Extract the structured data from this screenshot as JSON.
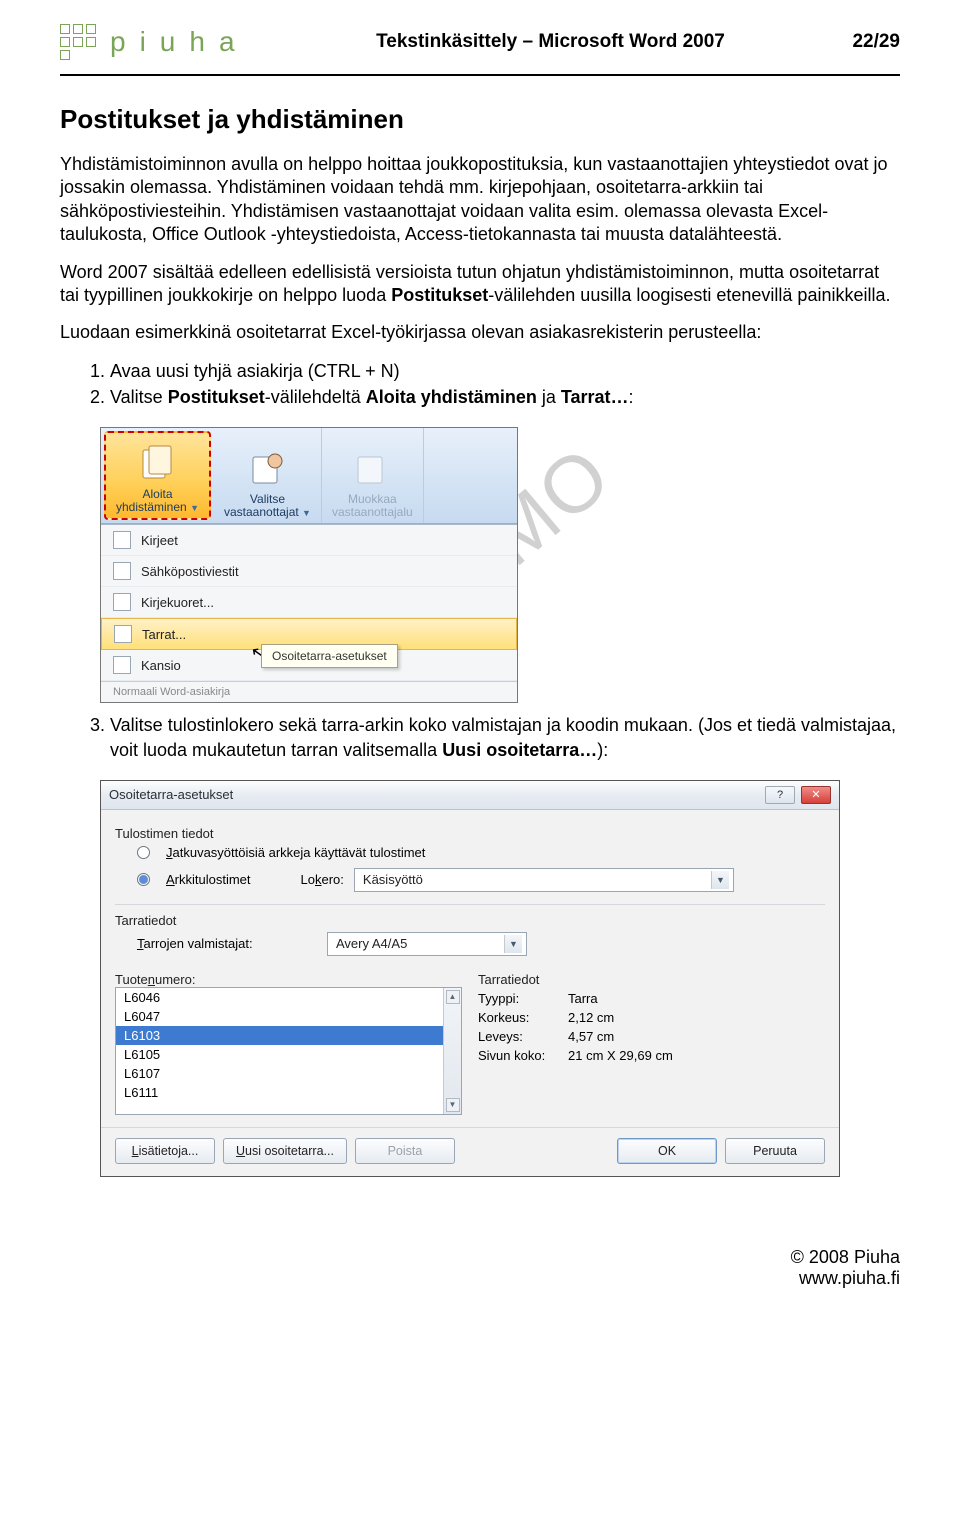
{
  "header": {
    "logo_text": "piuha",
    "doc_title": "Tekstinkäsittely – Microsoft Word 2007",
    "page_num": "22/29"
  },
  "watermark": "DEMO",
  "section_heading": "Postitukset ja yhdistäminen",
  "para1": "Yhdistämistoiminnon avulla on helppo hoittaa joukkopostituksia, kun vastaanottajien yhteystiedot ovat jo jossakin olemassa. Yhdistäminen voidaan tehdä mm. kirjepohjaan, osoitetarra-arkkiin tai sähköpostiviesteihin. Yhdistämisen vastaanottajat voidaan valita esim. olemassa olevasta Excel-taulukosta, Office Outlook -yhteystiedoista, Access-tietokannasta tai muusta datalähteestä.",
  "para2_pre": "Word 2007 sisältää edelleen edellisistä versioista tutun ohjatun yhdistämistoiminnon, mutta osoitetarrat tai tyypillinen joukkokirje on helppo luoda ",
  "para2_bold": "Postitukset",
  "para2_post": "-välilehden uusilla loogisesti etenevillä painikkeilla.",
  "para3": "Luodaan esimerkkinä osoitetarrat Excel-työkirjassa olevan asiakasrekisterin perusteella:",
  "list1": {
    "item1": "Avaa uusi tyhjä asiakirja (CTRL + N)",
    "item2_pre": "Valitse ",
    "item2_b1": "Postitukset",
    "item2_mid": "-välilehdeltä ",
    "item2_b2": "Aloita yhdistäminen",
    "item2_mid2": " ja ",
    "item2_b3": "Tarrat…",
    "item2_post": ":"
  },
  "shot1": {
    "ribbon": {
      "g1_l1": "Aloita",
      "g1_l2": "yhdistäminen",
      "g2_l1": "Valitse",
      "g2_l2": "vastaanottajat",
      "g3_l1": "Muokkaa",
      "g3_l2": "vastaanottajalu"
    },
    "menu": {
      "m1": "Kirjeet",
      "m2": "Sähköpostiviestit",
      "m3": "Kirjekuoret...",
      "m4": "Tarrat...",
      "m5": "Kansio",
      "cut": "Normaali Word-asiakirja"
    },
    "tooltip": "Osoitetarra-asetukset"
  },
  "list2": {
    "item3_pre": "Valitse tulostinlokero sekä tarra-arkin koko valmistajan ja koodin mukaan. (Jos et tiedä valmistajaa, voit luoda mukautetun tarran valitsemalla ",
    "item3_b": "Uusi osoitetarra…",
    "item3_post": "):"
  },
  "dialog": {
    "title": "Osoitetarra-asetukset",
    "sec_printer": "Tulostimen tiedot",
    "radio1_a": "J",
    "radio1_b": "atkuvasyöttöisiä arkkeja käyttävät tulostimet",
    "radio2_a": "A",
    "radio2_b": "rkkitulostimet",
    "tray_label_a": "Lo",
    "tray_label_b": "k",
    "tray_label_c": "ero:",
    "tray_val": "Käsisyöttö",
    "sec_label": "Tarratiedot",
    "vendor_label_a": "T",
    "vendor_label_b": "arrojen valmistajat:",
    "vendor_val": "Avery A4/A5",
    "productnum_a": "Tuote",
    "productnum_b": "n",
    "productnum_c": "umero:",
    "infohdr": "Tarratiedot",
    "info": {
      "k1": "Tyyppi:",
      "v1": "Tarra",
      "k2": "Korkeus:",
      "v2": "2,12 cm",
      "k3": "Leveys:",
      "v3": "4,57 cm",
      "k4": "Sivun koko:",
      "v4": "21 cm X 29,69 cm"
    },
    "list": [
      "L6046",
      "L6047",
      "L6103",
      "L6105",
      "L6107",
      "L6111"
    ],
    "selected_index": 2,
    "btn_details_a": "L",
    "btn_details_b": "isätietoja...",
    "btn_new_a": "U",
    "btn_new_b": "usi osoitetarra...",
    "btn_delete": "Poista",
    "btn_ok": "OK",
    "btn_cancel": "Peruuta"
  },
  "footer": {
    "copyright": "© 2008 Piuha",
    "url": "www.piuha.fi"
  }
}
